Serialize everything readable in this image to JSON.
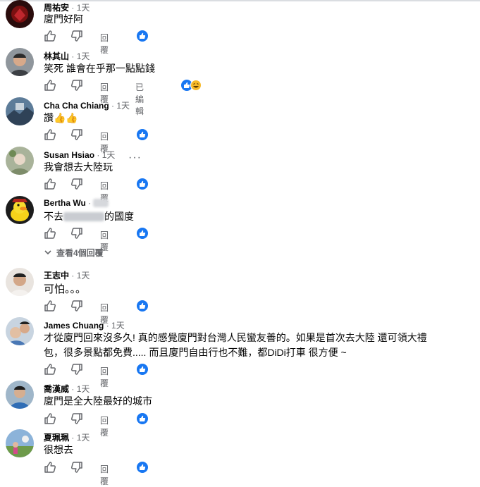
{
  "ui": {
    "reply_label": "回覆",
    "time_sep": "·",
    "edited_label": "已編輯",
    "view_replies": "查看4個回覆",
    "more_dots": "···"
  },
  "comments": [
    {
      "author": "周祐安",
      "time": "1天",
      "text": "廈門好阿"
    },
    {
      "author": "林其山",
      "time": "1天",
      "text": "笑死 誰會在乎那一點點錢"
    },
    {
      "author": "Cha Cha Chiang",
      "time": "1天",
      "text": "讚👍👍"
    },
    {
      "author": "Susan Hsiao",
      "time": "1天",
      "text": "我會想去大陸玩"
    },
    {
      "author": "Bertha Wu",
      "time": "1天",
      "text_pre": "不去",
      "text_post": "的國度"
    },
    {
      "author": "王志中",
      "time": "1天",
      "text": "可怕。。。"
    },
    {
      "author": "James Chuang",
      "time": "1天",
      "text": "才從廈門回來沒多久! 真的感覺廈門對台灣人民蠻友善的。如果是首次去大陸 還可領大禮",
      "text2": "包，很多景點都免費..... 而且廈門自由行也不難，都DiDi打車 很方便 ~"
    },
    {
      "author": "喬漢威",
      "time": "1天",
      "text": "廈門是全大陸最好的城市"
    },
    {
      "author": "夏珮珮",
      "time": "1天",
      "text": "很想去"
    }
  ],
  "icons": {
    "like": "thumbs-up-outline-icon",
    "dislike": "thumbs-down-outline-icon",
    "like_reaction": "like-reaction-icon",
    "haha_reaction": "haha-reaction-icon",
    "chevron": "chevron-down-icon"
  },
  "colors": {
    "text": "#050505",
    "secondary": "#65676b",
    "like_blue": "#1877f2",
    "haha_yellow": "#f7b928"
  }
}
